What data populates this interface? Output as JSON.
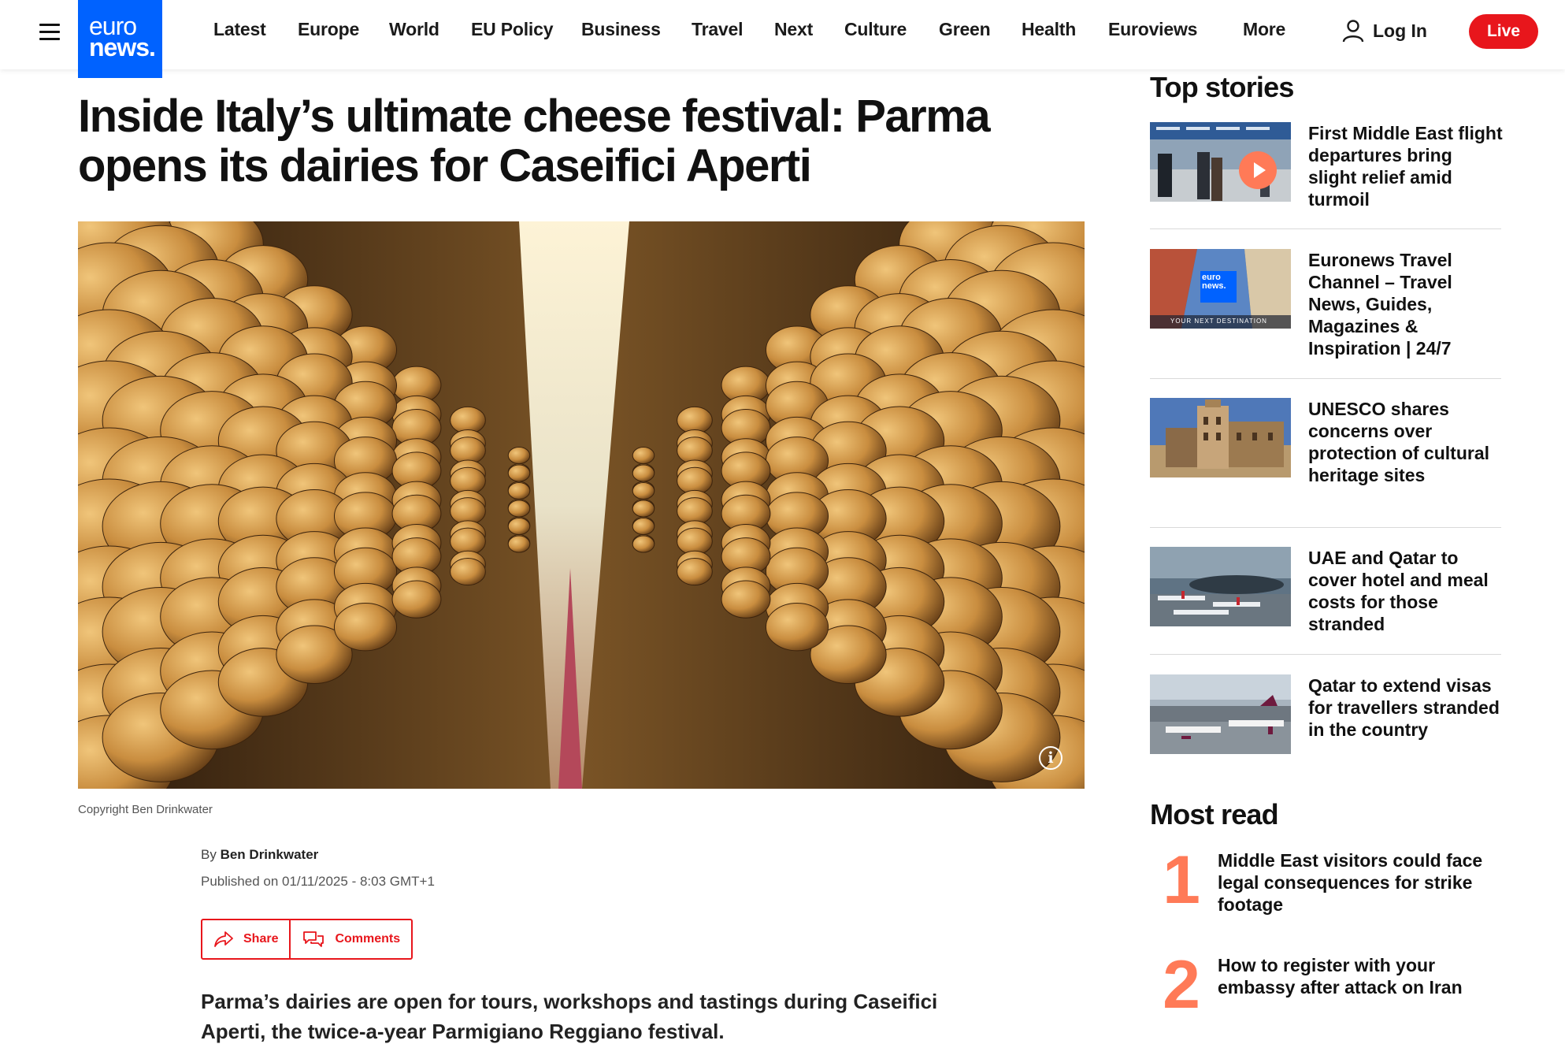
{
  "header": {
    "logo_line1": "euro",
    "logo_line2": "news.",
    "nav": [
      "Latest",
      "Europe",
      "World",
      "EU Policy",
      "Business",
      "Travel",
      "Next",
      "Culture",
      "Green",
      "Health",
      "Euroviews",
      "More"
    ],
    "login_label": "Log In",
    "live_label": "Live",
    "brand_color": "#0062ff",
    "live_color": "#e8161c"
  },
  "article": {
    "headline_line1": "Inside Italy’s ultimate cheese festival: Parma",
    "headline_line2": "opens its dairies for Caseifici Aperti",
    "copyright": "Copyright Ben Drinkwater",
    "by_prefix": "By",
    "author": "Ben Drinkwater",
    "published": "Published on 01/11/2025 - 8:03 GMT+1",
    "share_label": "Share",
    "comments_label": "Comments",
    "lead_line1": "Parma’s dairies are open for tours, workshops and tastings during Caseifici",
    "lead_line2": "Aperti, the twice-a-year Parmigiano Reggiano festival.",
    "info_icon": "info-icon"
  },
  "top_stories": {
    "title": "Top stories",
    "items": [
      {
        "title": "First Middle East flight departures bring slight relief amid turmoil",
        "has_play": true
      },
      {
        "title": "Euronews Travel Channel – Travel News, Guides, Magazines & Inspiration | 24/7",
        "thumb_logo_line1": "euro",
        "thumb_logo_line2": "news.",
        "thumb_caption": "YOUR NEXT DESTINATION"
      },
      {
        "title": "UNESCO shares concerns over protection of cultural heritage sites"
      },
      {
        "title": "UAE and Qatar to cover hotel and meal costs for those stranded"
      },
      {
        "title": "Qatar to extend visas for travellers stranded in the country"
      }
    ]
  },
  "most_read": {
    "title": "Most read",
    "items": [
      {
        "num": "1",
        "title": "Middle East visitors could face legal consequences for strike footage"
      },
      {
        "num": "2",
        "title": "How to register with your embassy after attack on Iran"
      }
    ],
    "accent": "#ff7a57"
  }
}
